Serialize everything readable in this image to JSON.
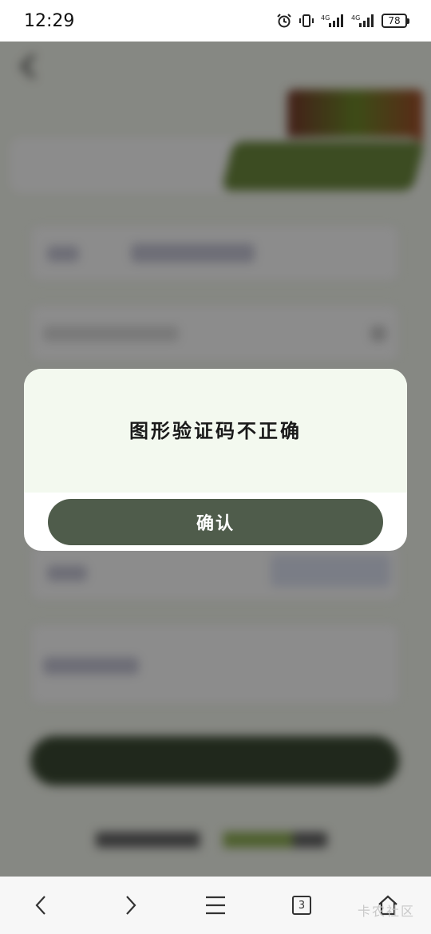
{
  "status_bar": {
    "time": "12:29",
    "signal_1": "4G",
    "signal_2": "4G",
    "battery": "78"
  },
  "dialog": {
    "message": "图形验证码不正确",
    "confirm_label": "确认"
  },
  "bottom_nav": {
    "tab_count": "3"
  },
  "watermark": "卡农社区",
  "colors": {
    "dialog_body_bg": "#f3f9ef",
    "confirm_button_bg": "#4f5c4b",
    "overlay": "rgba(0,0,0,0.45)",
    "accent_green": "#6d8a3e"
  },
  "icons": [
    "alarm-icon",
    "vibrate-icon",
    "signal-icon",
    "battery-icon",
    "back-arrow-icon",
    "forward-arrow-icon",
    "menu-icon",
    "tabs-icon",
    "home-icon"
  ]
}
